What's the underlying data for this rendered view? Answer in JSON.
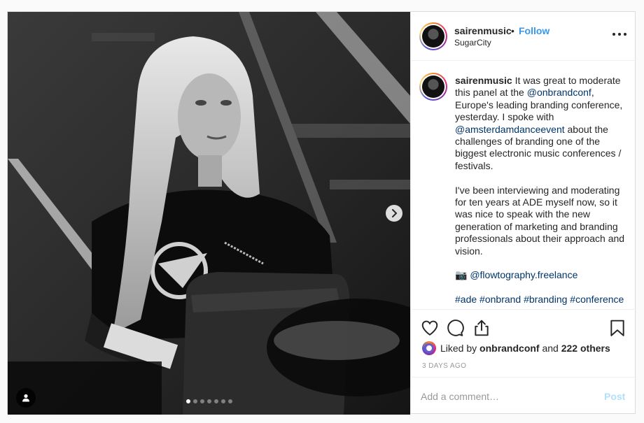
{
  "post": {
    "username": "sairenmusic",
    "separator": "•",
    "follow_label": "Follow",
    "location": "SugarCity",
    "media": {
      "slide_count": 7,
      "active_slide": 1
    },
    "caption": {
      "username": "sairenmusic",
      "part1": " It was great to moderate this panel at the ",
      "mention1": "@onbrandconf",
      "part2": ", Europe's leading branding conference, yesterday. I spoke with ",
      "mention2": "@amsterdamdanceevent",
      "part3": " about the challenges of branding one of the biggest electronic music conferences / festivals.",
      "paragraph2": "I've been interviewing and moderating for ten years at ADE myself now, so it was nice to speak with the new generation of marketing and branding professionals about their approach and vision.",
      "camera_emoji": "📷",
      "photo_credit": "@flowtography.freelance",
      "hashtags": [
        "#ade",
        "#onbrand",
        "#branding",
        "#conference"
      ]
    },
    "likes": {
      "prefix": "Liked by ",
      "user": "onbrandconf",
      "middle": " and ",
      "others": "222 others"
    },
    "timestamp": "3 DAYS AGO",
    "comment": {
      "placeholder": "Add a comment…",
      "value": "",
      "post_label": "Post"
    }
  },
  "colors": {
    "link": "#3897f0",
    "mention": "#003569",
    "post_disabled": "#b2dffc",
    "meta": "#999999"
  },
  "icons": [
    "more-icon",
    "heart-icon",
    "comment-icon",
    "share-icon",
    "bookmark-icon",
    "chevron-right-icon",
    "user-tag-icon",
    "camera-emoji"
  ]
}
